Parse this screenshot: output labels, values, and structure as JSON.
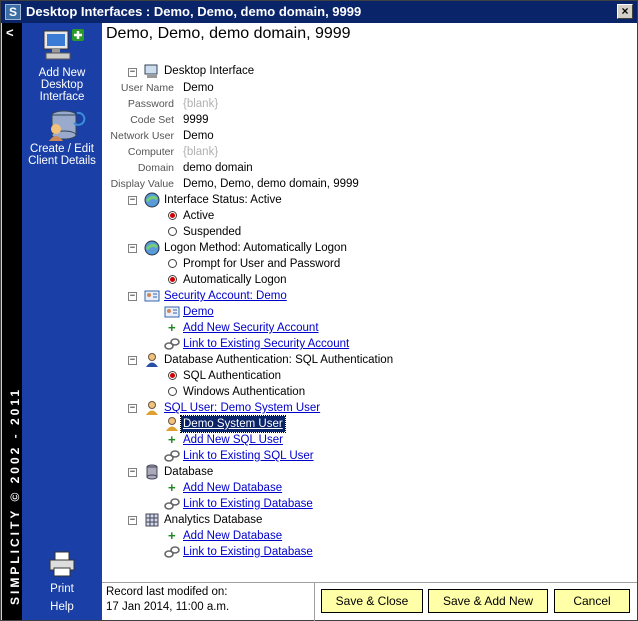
{
  "window": {
    "title": "Desktop Interfaces : Demo, Demo, demo domain, 9999",
    "app_icon": "S"
  },
  "brand": {
    "collapse_glyph": "<",
    "vertical_text": "SIMPLICITY © 2002 - 2011"
  },
  "sidebar": {
    "add_label": "Add New Desktop Interface",
    "client_label": "Create / Edit Client Details",
    "print_label": "Print",
    "help_label": "Help"
  },
  "header": {
    "title": "Demo, Demo, demo domain, 9999"
  },
  "tree": {
    "root_label": "Desktop Interface",
    "fields": [
      {
        "label": "User Name",
        "value": "Demo",
        "blank": false
      },
      {
        "label": "Password",
        "value": "{blank}",
        "blank": true
      },
      {
        "label": "Code Set",
        "value": "9999",
        "blank": false
      },
      {
        "label": "Network User",
        "value": "Demo",
        "blank": false
      },
      {
        "label": "Computer",
        "value": "{blank}",
        "blank": true
      },
      {
        "label": "Domain",
        "value": "demo domain",
        "blank": false
      },
      {
        "label": "Display Value",
        "value": "Demo, Demo, demo domain, 9999",
        "blank": false
      }
    ],
    "interface_status": {
      "label": "Interface Status:  Active",
      "options": [
        "Active",
        "Suspended"
      ],
      "selected": 0
    },
    "logon_method": {
      "label": "Logon Method:  Automatically Logon",
      "options": [
        "Prompt for User and Password",
        "Automatically Logon"
      ],
      "selected": 1
    },
    "security_account": {
      "label": "Security Account:  Demo",
      "item": "Demo",
      "add": "Add New Security Account",
      "link": "Link to Existing Security Account"
    },
    "db_auth": {
      "label": "Database Authentication:  SQL Authentication",
      "options": [
        "SQL Authentication",
        "Windows Authentication"
      ],
      "selected": 0
    },
    "sql_user": {
      "label": "SQL User:  Demo System User",
      "item": "Demo System User",
      "add": "Add New SQL User",
      "link": "Link to Existing SQL User"
    },
    "database": {
      "label": "Database",
      "add": "Add New Database",
      "link": "Link to Existing Database"
    },
    "analytics": {
      "label": "Analytics Database",
      "add": "Add New Database",
      "link": "Link to Existing Database"
    }
  },
  "footer": {
    "modified_label": "Record last modifed on:",
    "modified_value": "17 Jan 2014, 11:00 a.m.",
    "save_close": "Save & Close",
    "save_add_new": "Save & Add New",
    "cancel": "Cancel"
  }
}
